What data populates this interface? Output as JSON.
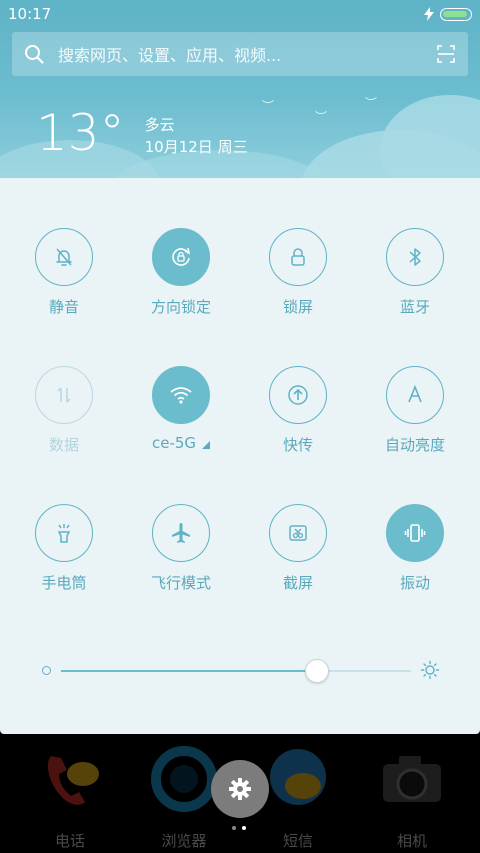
{
  "status": {
    "time": "10:17"
  },
  "search": {
    "placeholder": "搜索网页、设置、应用、视频..."
  },
  "weather": {
    "temperature": "13°",
    "condition": "多云",
    "date": "10月12日 周三"
  },
  "tiles": [
    {
      "label": "静音",
      "icon": "bell-off-icon",
      "state": "off"
    },
    {
      "label": "方向锁定",
      "icon": "rotation-lock-icon",
      "state": "on"
    },
    {
      "label": "锁屏",
      "icon": "lock-icon",
      "state": "off"
    },
    {
      "label": "蓝牙",
      "icon": "bluetooth-icon",
      "state": "off"
    },
    {
      "label": "数据",
      "icon": "mobile-data-icon",
      "state": "disabled"
    },
    {
      "label": "ce-5G",
      "icon": "wifi-icon",
      "state": "on"
    },
    {
      "label": "快传",
      "icon": "quick-transfer-icon",
      "state": "off"
    },
    {
      "label": "自动亮度",
      "icon": "auto-brightness-icon",
      "state": "off"
    },
    {
      "label": "手电筒",
      "icon": "flashlight-icon",
      "state": "off"
    },
    {
      "label": "飞行模式",
      "icon": "airplane-icon",
      "state": "off"
    },
    {
      "label": "截屏",
      "icon": "screenshot-icon",
      "state": "off"
    },
    {
      "label": "振动",
      "icon": "vibrate-icon",
      "state": "on"
    }
  ],
  "brightness": {
    "level": 0.73
  },
  "dock": {
    "apps": [
      {
        "label": "电话",
        "icon": "phone-icon"
      },
      {
        "label": "浏览器",
        "icon": "browser-icon"
      },
      {
        "label": "短信",
        "icon": "messages-icon"
      },
      {
        "label": "相机",
        "icon": "camera-icon"
      }
    ]
  },
  "colors": {
    "accent": "#5fb3c7",
    "panel": "#eaf3f5",
    "header": "#6dbdd0"
  }
}
